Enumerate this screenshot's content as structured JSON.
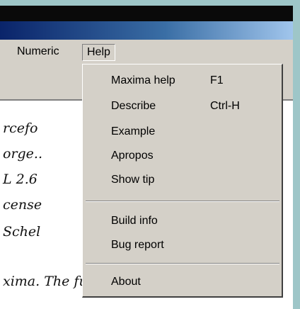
{
  "menubar": {
    "items": [
      "Numeric",
      "Help"
    ]
  },
  "console": {
    "lines": [
      "rcefo",
      "orge..",
      "L 2.6",
      "cense",
      "Schel",
      "xima. The function b"
    ]
  },
  "help_menu": {
    "items": [
      {
        "label": "Maxima help",
        "shortcut": "F1"
      },
      {
        "label": "Describe",
        "shortcut": "Ctrl-H"
      },
      {
        "label": "Example",
        "shortcut": ""
      },
      {
        "label": "Apropos",
        "shortcut": ""
      },
      {
        "label": "Show tip",
        "shortcut": ""
      },
      {
        "label": "Build info",
        "shortcut": ""
      },
      {
        "label": "Bug report",
        "shortcut": ""
      },
      {
        "label": "About",
        "shortcut": ""
      }
    ]
  },
  "colors": {
    "menu_background": "#d4d0c8",
    "title_bar_start": "#0a246a",
    "title_bar_end": "#a6caf0"
  }
}
